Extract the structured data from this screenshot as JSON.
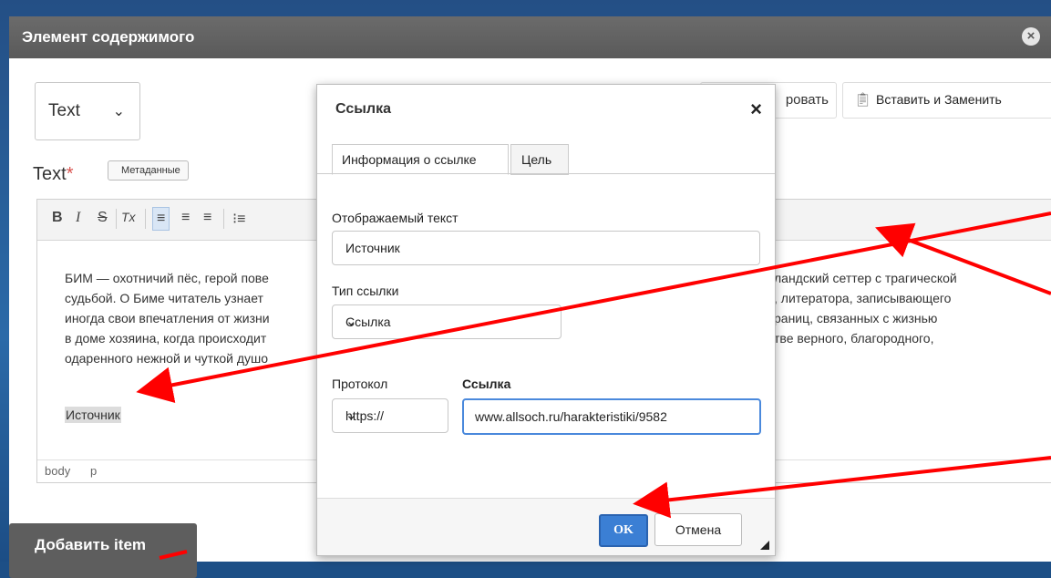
{
  "window": {
    "title": "Элемент содержимого",
    "close_icon": "×"
  },
  "type_select": {
    "value": "Text",
    "chevron": "⌄"
  },
  "toolbar_right": {
    "partial_button": "ровать",
    "paste_replace": "Вставить и Заменить",
    "paste_icon": "clipboard-icon"
  },
  "field": {
    "label": "Text",
    "required_mark": "*",
    "metadata_tag": "Метаданные"
  },
  "editor_toolbar": {
    "bold": "B",
    "italic": "I",
    "strike": "S",
    "clear": "Tx",
    "align_left": "≡",
    "align_center": "≡",
    "align_right": "≡",
    "list": "⁝≡"
  },
  "content_lines": {
    "l1a": "БИМ — охотничий пёс, герой пове",
    "l1b": "ландский сеттер с трагической",
    "l2a": "судьбой. О Биме читатель узнает",
    "l2b": ", литератора, записывающего",
    "l3a": "иногда свои впечатления от жизни",
    "l3b": "раниц, связанных с жизнью",
    "l4a": "в доме хозяина, когда происходит",
    "l4b": "тве верного, благородного,",
    "l5a": "одаренного нежной и чуткой душо"
  },
  "link_text": "Источник",
  "path_bar": {
    "body": "body",
    "p": "p"
  },
  "add_item": "Добавить item",
  "dialog": {
    "title": "Ссылка",
    "close": "×",
    "tabs": [
      "Информация о ссылке",
      "Цель"
    ],
    "display_text_label": "Отображаемый текст",
    "display_text_value": "Источник",
    "link_type_label": "Тип ссылки",
    "link_type_value": "Ссылка",
    "protocol_label": "Протокол",
    "protocol_value": "https://",
    "url_label": "Ссылка",
    "url_value": "www.allsoch.ru/harakteristiki/9582",
    "ok": "OK",
    "cancel": "Отмена"
  },
  "colors": {
    "header": "#5f5f5f",
    "ok": "#3b7fd4",
    "arrow": "#ff0000"
  }
}
